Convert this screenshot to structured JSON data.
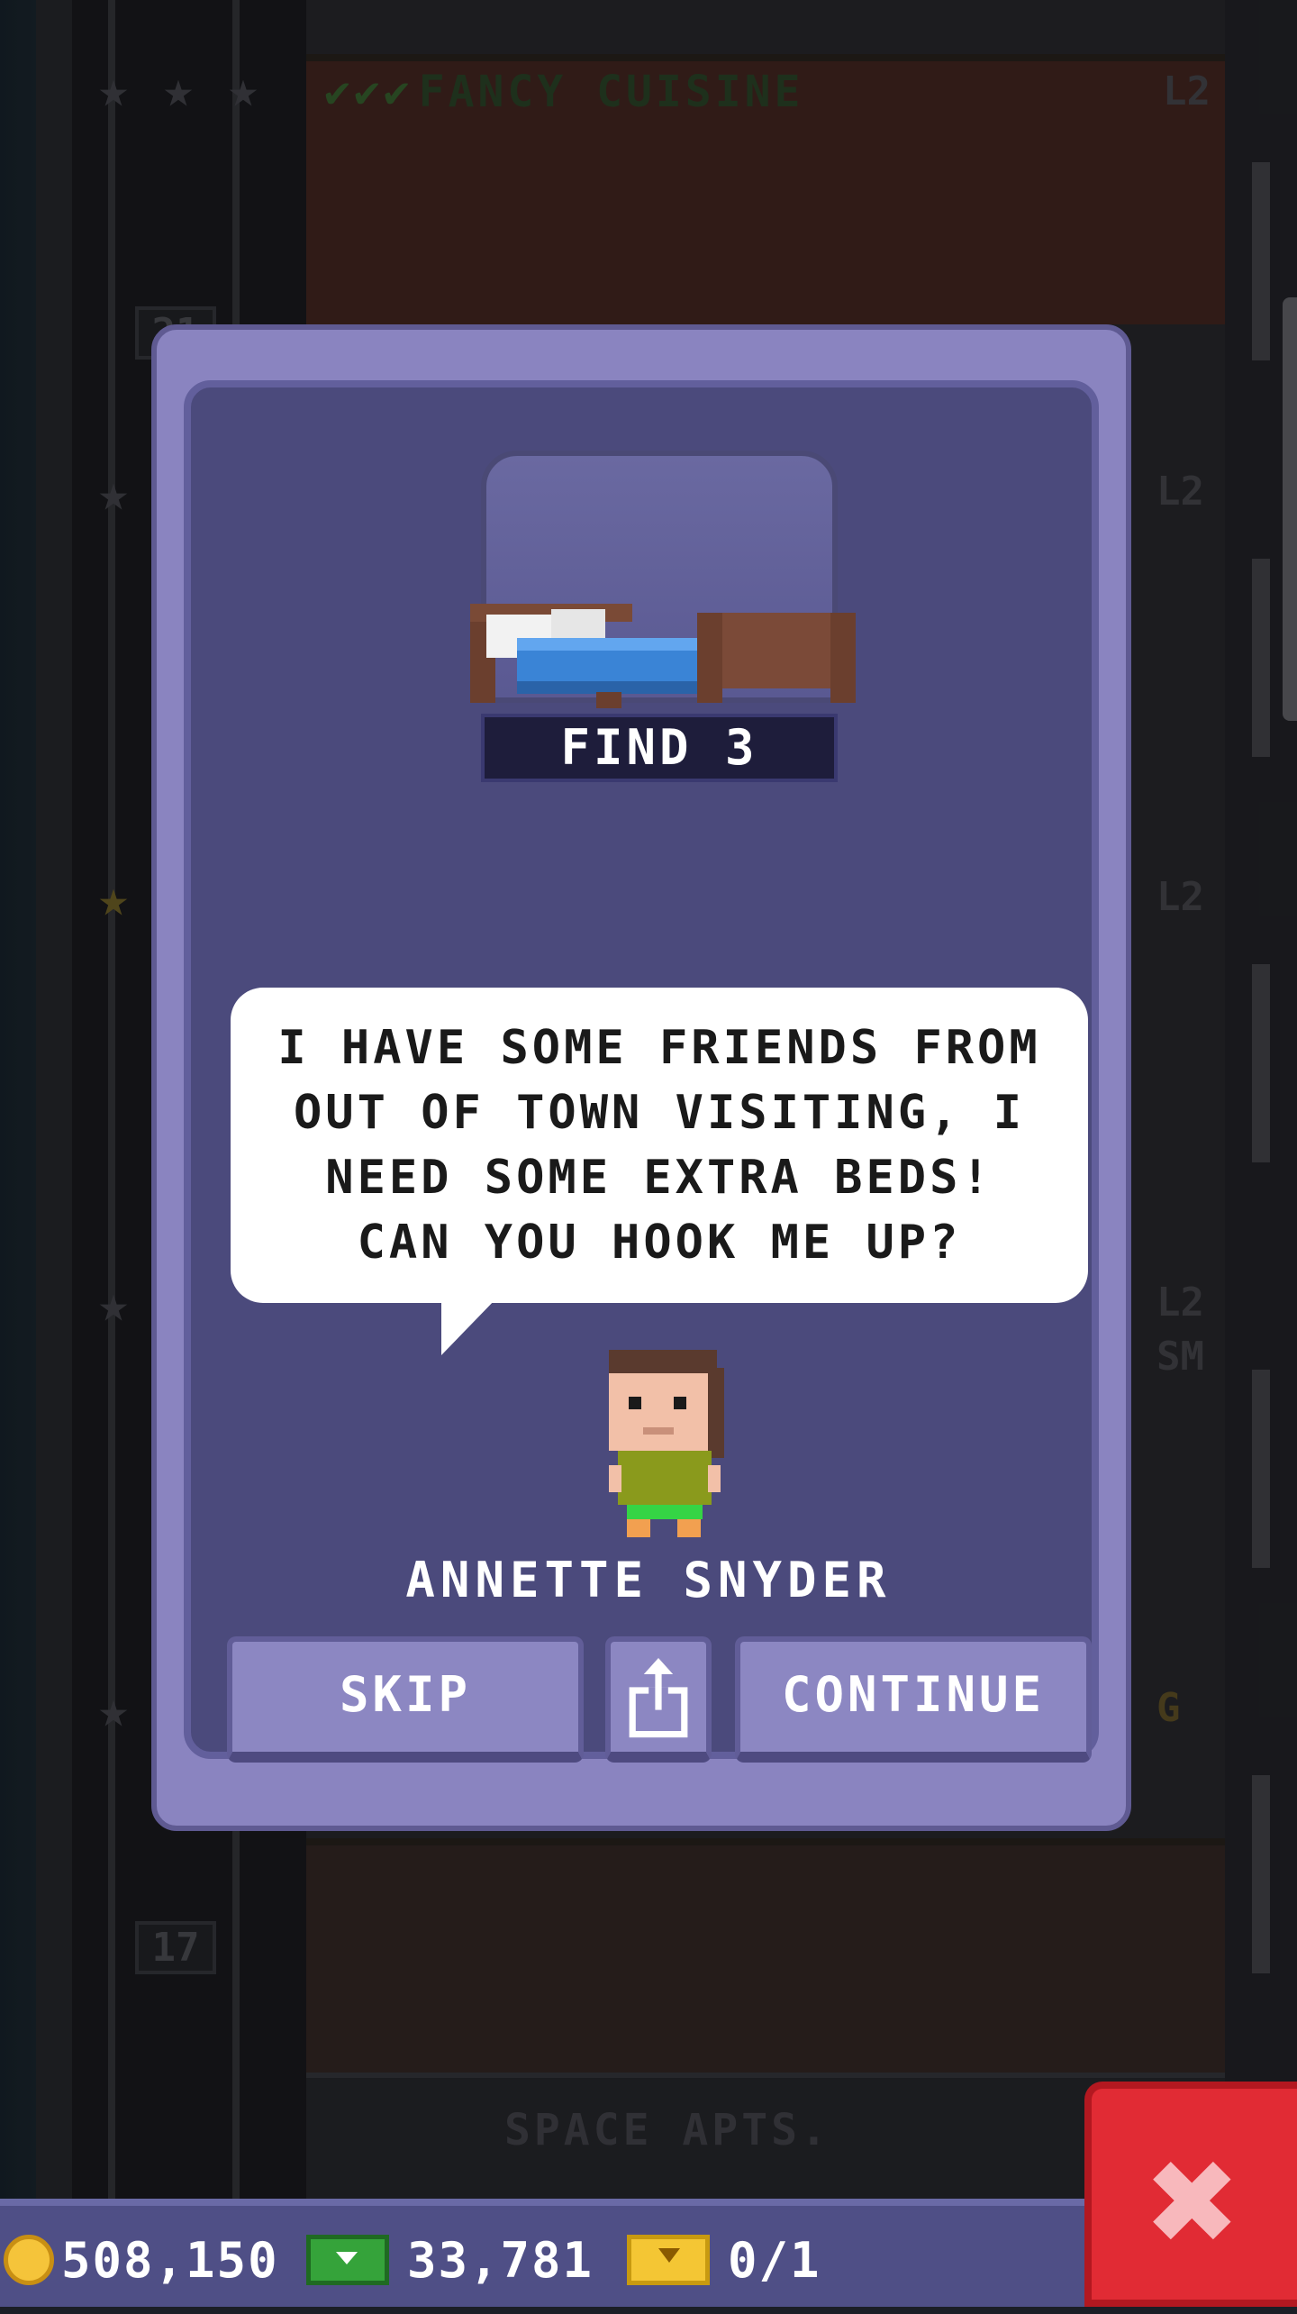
{
  "background": {
    "top_room": {
      "name": "FANCY CUISINE",
      "checks": "✔✔✔",
      "level": "L2"
    },
    "side_levels": [
      "L2",
      "L2",
      "L2",
      "SM",
      "G"
    ],
    "floor_numbers": [
      "21",
      "17"
    ],
    "bottom_room": {
      "name": "SPACE APTS."
    }
  },
  "modal": {
    "find_label": "FIND 3",
    "item_icon": "bed-icon",
    "speech": "I HAVE SOME FRIENDS FROM OUT OF TOWN VISITING, I NEED SOME EXTRA BEDS! CAN YOU HOOK ME UP?",
    "person_name": "ANNETTE SNYDER",
    "buttons": {
      "skip": "SKIP",
      "share_icon": "share-icon",
      "continue": "CONTINUE"
    }
  },
  "status_bar": {
    "coins": "508,150",
    "bux": "33,781",
    "tickets": "0/1"
  },
  "close_icon": "✖",
  "colors": {
    "modal_outer": "#8a84c0",
    "modal_inner": "#4b4a7c",
    "button": "#8c87c2",
    "close_button": "#e12b34",
    "status_bar": "#4f4f86"
  }
}
